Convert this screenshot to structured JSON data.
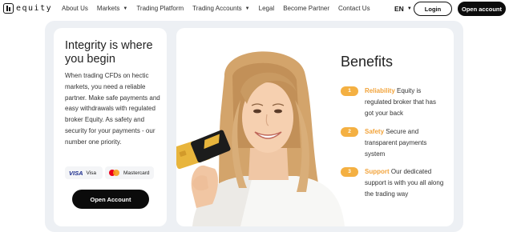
{
  "brand": {
    "logo_text": "equity"
  },
  "nav": {
    "items": [
      {
        "label": "About Us",
        "has_caret": false
      },
      {
        "label": "Markets",
        "has_caret": true
      },
      {
        "label": "Trading Platform",
        "has_caret": false
      },
      {
        "label": "Trading Accounts",
        "has_caret": true
      },
      {
        "label": "Legal",
        "has_caret": false
      },
      {
        "label": "Become Partner",
        "has_caret": false
      },
      {
        "label": "Contact Us",
        "has_caret": false
      }
    ],
    "caret": "▼",
    "language": "EN",
    "login_label": "Login",
    "open_account_label": "Open account"
  },
  "left": {
    "title": "Integrity is where you begin",
    "description": "When trading CFDs on hectic markets, you need a reliable partner. Make safe payments and easy withdrawals with regulated broker Equity. As safety and security for your payments - our number one priority.",
    "payments": [
      {
        "mark": "VISA",
        "label": "Visa",
        "icon": "visa-icon"
      },
      {
        "label": "Mastercard",
        "icon": "mastercard-icon"
      }
    ],
    "cta_label": "Open Account"
  },
  "benefits": {
    "title": "Benefits",
    "items": [
      {
        "num": "1",
        "highlight": "Reliability",
        "text": " Equity is regulated broker that has got your back"
      },
      {
        "num": "2",
        "highlight": "Safety",
        "text": " Secure and transparent payments system"
      },
      {
        "num": "3",
        "highlight": "Support",
        "text": " Our dedicated support is with you all along the trading way"
      }
    ]
  },
  "colors": {
    "accent": "#f4b042",
    "highlight_text": "#f2a33a",
    "dark_button": "#0b0b0b",
    "section_bg": "#edf0f4"
  }
}
